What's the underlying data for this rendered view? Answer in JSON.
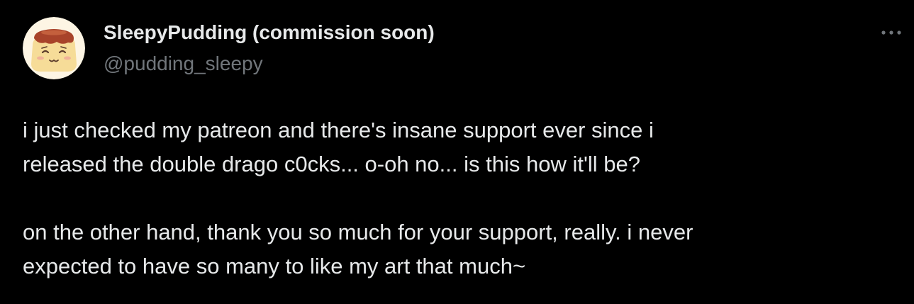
{
  "author": {
    "display_name": "SleepyPudding (commission soon)",
    "handle": "@pudding_sleepy",
    "avatar_icon": "pudding-face-avatar"
  },
  "menu": {
    "more_icon": "more-horizontal-icon"
  },
  "tweet": {
    "paragraphs": [
      "i just checked my patreon and there's insane support ever since i\nreleased the double drago c0cks... o-oh no... is this how it'll be?",
      "on the other hand, thank you so much for your support, really. i never\nexpected to have so many to like my art that much~"
    ]
  },
  "colors": {
    "background": "#000000",
    "text_primary": "#e7e9ea",
    "text_secondary": "#71767b",
    "avatar_bg": "#fdf5e4",
    "pudding_caramel": "#a8432a",
    "pudding_custard": "#f6dc98"
  }
}
